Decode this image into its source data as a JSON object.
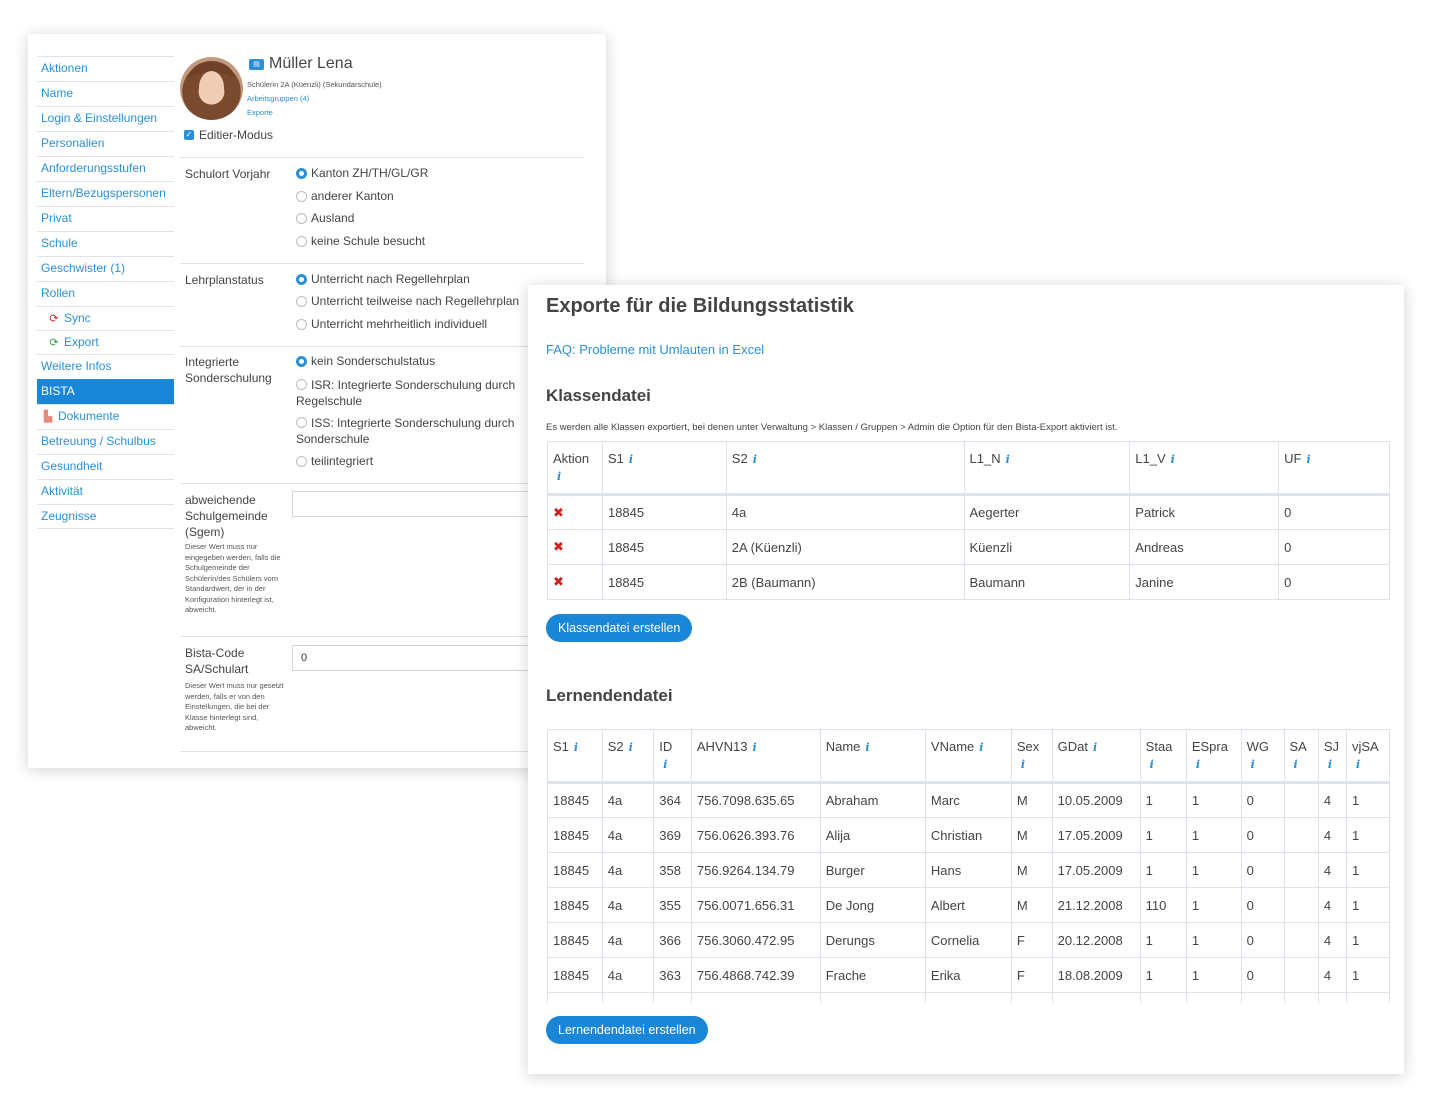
{
  "sidebar": {
    "items": [
      {
        "label": "Aktionen"
      },
      {
        "label": "Name"
      },
      {
        "label": "Login & Einstellungen"
      },
      {
        "label": "Personalien"
      },
      {
        "label": "Anforderungsstufen"
      },
      {
        "label": "Eltern/Bezugspersonen"
      },
      {
        "label": "Privat"
      },
      {
        "label": "Schule"
      },
      {
        "label": "Geschwister (1)"
      },
      {
        "label": "Rollen"
      },
      {
        "label": "Sync",
        "icon": "sync-icon",
        "color": "#d02020"
      },
      {
        "label": "Export",
        "icon": "sync-icon",
        "color": "#2aa04a"
      },
      {
        "label": "Weitere Infos"
      },
      {
        "label": "BISTA",
        "active": true
      },
      {
        "label": "Dokumente",
        "icon": "document-icon"
      },
      {
        "label": "Betreuung / Schulbus"
      },
      {
        "label": "Gesundheit"
      },
      {
        "label": "Aktivität"
      },
      {
        "label": "Zeugnisse"
      }
    ]
  },
  "profile": {
    "name": "Müller Lena",
    "class_info": "Schülerin 2A (Küenzli) (Sekundarschule)",
    "workgroups_link": "Arbeitsgruppen (4)",
    "exports_link": "Exporte",
    "edit_mode_label": "Editier-Modus",
    "edit_mode_checked": true
  },
  "form": {
    "schulort": {
      "label": "Schulort Vorjahr",
      "options": [
        "Kanton ZH/TH/GL/GR",
        "anderer Kanton",
        "Ausland",
        "keine Schule besucht"
      ],
      "selected": "Kanton ZH/TH/GL/GR"
    },
    "lehrplan": {
      "label": "Lehrplanstatus",
      "options": [
        "Unterricht nach Regellehrplan",
        "Unterricht teilweise nach Regellehrplan",
        "Unterricht mehrheitlich individuell"
      ],
      "selected": "Unterricht nach Regellehrplan"
    },
    "sonderschulung": {
      "label": "Integrierte Sonderschulung",
      "options": [
        "kein Sonderschulstatus",
        "ISR: Integrierte Sonderschulung durch Regelschule",
        "ISS: Integrierte Sonderschulung durch Sonderschule",
        "teilintegriert"
      ],
      "selected": "kein Sonderschulstatus"
    },
    "sgem": {
      "label": "abweichende Schulgemeinde (Sgem)",
      "help": "Dieser Wert muss nur eingegeben werden, falls die Schulgemeinde der Schülerin/des Schülers vom Standardwert, der in der Konfiguration hinterlegt ist, abweicht.",
      "value": ""
    },
    "bista_code": {
      "label": "Bista-Code SA/Schulart",
      "help": "Dieser Wert muss nur gesetzt werden, falls er von den Einstellungen, die bei der Klasse hinterlegt sind, abweicht.",
      "value": "0"
    }
  },
  "export": {
    "title": "Exporte für die Bildungsstatistik",
    "faq_link": "FAQ: Probleme mit Umlauten in Excel",
    "klassen": {
      "heading": "Klassendatei",
      "note": "Es werden alle Klassen exportiert, bei denen unter Verwaltung > Klassen / Gruppen > Admin die Option für den Bista-Export aktiviert ist.",
      "columns": [
        "Aktion",
        "S1",
        "S2",
        "L1_N",
        "L1_V",
        "UF"
      ],
      "rows": [
        [
          "18845",
          "4a",
          "Aegerter",
          "Patrick",
          "0"
        ],
        [
          "18845",
          "2A (Küenzli)",
          "Küenzli",
          "Andreas",
          "0"
        ],
        [
          "18845",
          "2B (Baumann)",
          "Baumann",
          "Janine",
          "0"
        ]
      ],
      "button": "Klassendatei erstellen"
    },
    "lernende": {
      "heading": "Lernendendatei",
      "columns": [
        "S1",
        "S2",
        "ID",
        "AHVN13",
        "Name",
        "VName",
        "Sex",
        "GDat",
        "Staa",
        "ESpra",
        "WG",
        "SA",
        "SJ",
        "vjSA"
      ],
      "rows": [
        [
          "18845",
          "4a",
          "364",
          "756.7098.635.65",
          "Abraham",
          "Marc",
          "M",
          "10.05.2009",
          "1",
          "1",
          "0",
          "",
          "4",
          "1"
        ],
        [
          "18845",
          "4a",
          "369",
          "756.0626.393.76",
          "Alija",
          "Christian",
          "M",
          "17.05.2009",
          "1",
          "1",
          "0",
          "",
          "4",
          "1"
        ],
        [
          "18845",
          "4a",
          "358",
          "756.9264.134.79",
          "Burger",
          "Hans",
          "M",
          "17.05.2009",
          "1",
          "1",
          "0",
          "",
          "4",
          "1"
        ],
        [
          "18845",
          "4a",
          "355",
          "756.0071.656.31",
          "De Jong",
          "Albert",
          "M",
          "21.12.2008",
          "110",
          "1",
          "0",
          "",
          "4",
          "1"
        ],
        [
          "18845",
          "4a",
          "366",
          "756.3060.472.95",
          "Derungs",
          "Cornelia",
          "F",
          "20.12.2008",
          "1",
          "1",
          "0",
          "",
          "4",
          "1"
        ],
        [
          "18845",
          "4a",
          "363",
          "756.4868.742.39",
          "Frache",
          "Erika",
          "F",
          "18.08.2009",
          "1",
          "1",
          "0",
          "",
          "4",
          "1"
        ]
      ],
      "button": "Lernendendatei erstellen"
    }
  },
  "colors": {
    "accent": "#1a86d8",
    "link": "#2a8fd6",
    "danger": "#d02020"
  }
}
